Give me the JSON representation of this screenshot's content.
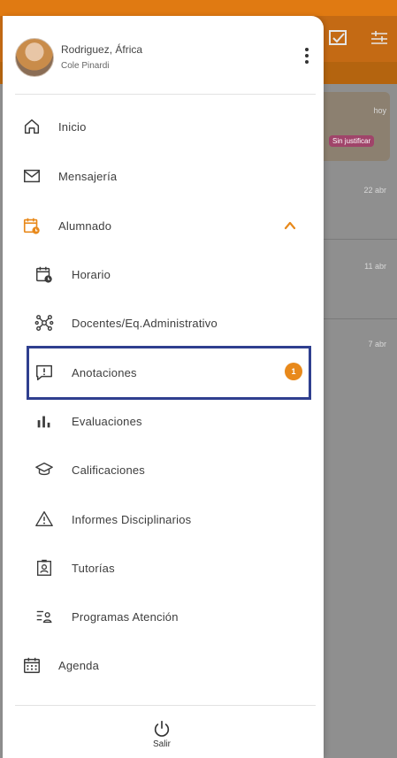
{
  "background": {
    "dates": [
      "hoy",
      "22 abr",
      "11 abr",
      "7 abr"
    ],
    "tag": "Sin justificar"
  },
  "profile": {
    "name": "Rodriguez, África",
    "subtitle": "Cole Pinardi"
  },
  "menu": {
    "inicio": "Inicio",
    "mensajeria": "Mensajería",
    "alumnado": "Alumnado",
    "horario": "Horario",
    "docentes": "Docentes/Eq.Administrativo",
    "anotaciones": "Anotaciones",
    "anotaciones_badge": "1",
    "evaluaciones": "Evaluaciones",
    "calificaciones": "Calificaciones",
    "informes": "Informes Disciplinarios",
    "tutorias": "Tutorías",
    "programas": "Programas Atención",
    "agenda": "Agenda"
  },
  "logout": {
    "label": "Salir"
  },
  "colors": {
    "accent": "#e8891b",
    "highlight_border": "#2f3f8f",
    "topbar": "#c46a14"
  },
  "icons": {
    "inicio": "home-icon",
    "mensajeria": "mail-icon",
    "alumnado": "calendar-clock-icon",
    "horario": "calendar-clock-icon",
    "docentes": "network-icon",
    "anotaciones": "alert-message-icon",
    "evaluaciones": "bar-chart-icon",
    "calificaciones": "graduation-cap-icon",
    "informes": "warning-icon",
    "tutorias": "id-badge-icon",
    "programas": "list-person-icon",
    "agenda": "calendar-grid-icon",
    "logout": "power-icon"
  }
}
